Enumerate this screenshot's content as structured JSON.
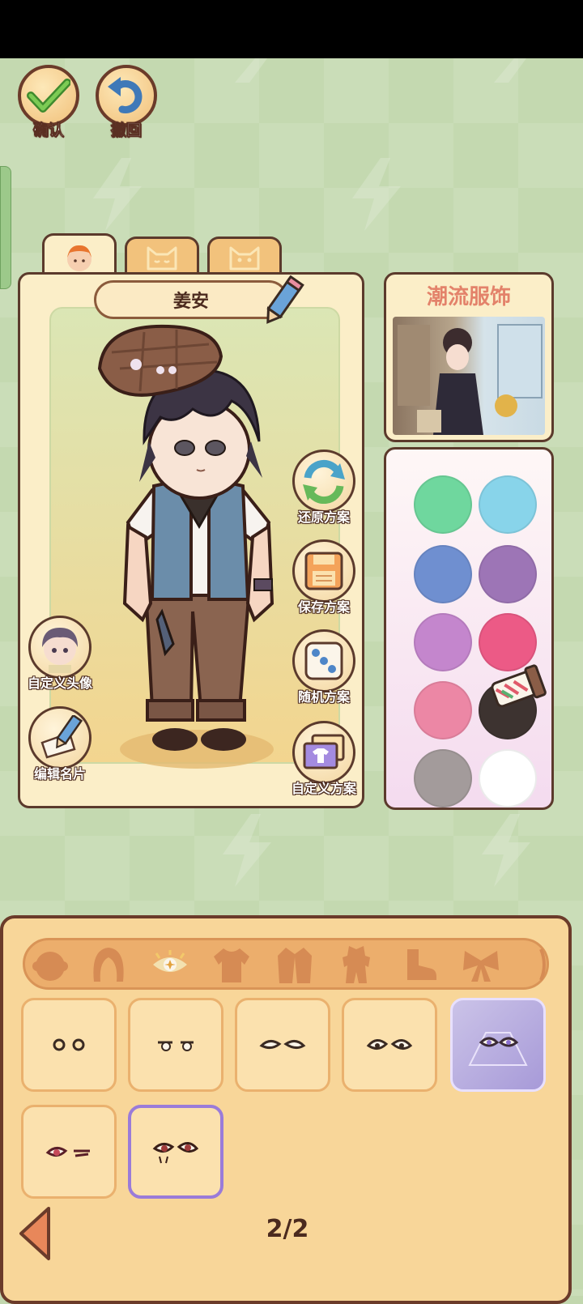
{
  "top_buttons": {
    "confirm_label": "确认",
    "undo_label": "撤回"
  },
  "character": {
    "name": "姜安"
  },
  "tabs": [
    "human-face-icon",
    "cat-face-icon",
    "cat-face-icon"
  ],
  "side_actions": {
    "restore_label": "还原方案",
    "save_label": "保存方案",
    "random_label": "随机方案",
    "custom_label": "自定义方案",
    "avatar_label": "自定义头像",
    "card_label": "编辑名片"
  },
  "fashion": {
    "title": "潮流服饰"
  },
  "colors": {
    "swatches": [
      "#6fd79e",
      "#88d4ea",
      "#6f8fd0",
      "#9d75b6",
      "#c486cd",
      "#ec5a86",
      "#ec87a5",
      "#3d3330",
      "#a39b9b",
      "#ffffff"
    ]
  },
  "categories": [
    "face-icon",
    "hair-icon",
    "eyes-icon",
    "top-icon",
    "coat-icon",
    "dress-icon",
    "shoes-icon",
    "bow-icon"
  ],
  "pager": {
    "text": "2/2"
  }
}
